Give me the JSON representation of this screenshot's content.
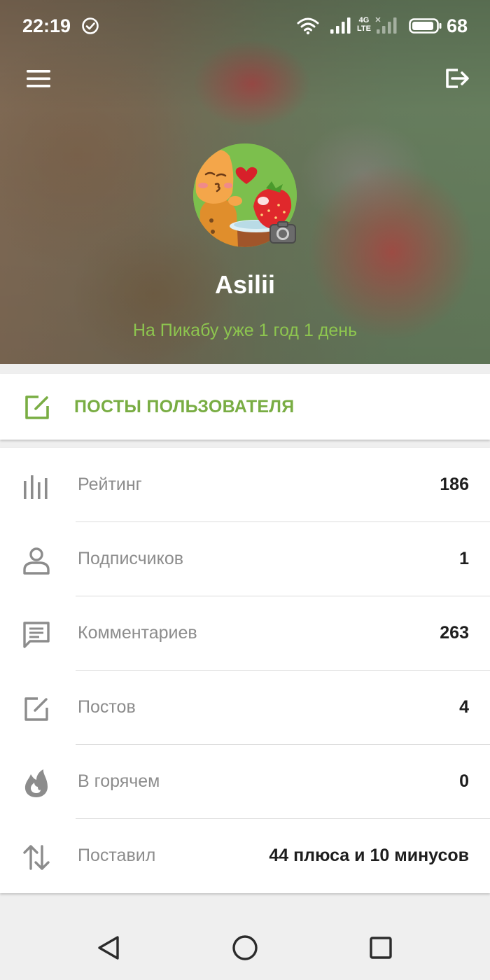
{
  "status_bar": {
    "time": "22:19",
    "network_label_top": "4G",
    "network_label_bottom": "LTE",
    "battery_level": "68"
  },
  "header": {
    "username": "Asilii",
    "member_since": "На Пикабу уже 1 год 1 день"
  },
  "posts_button": {
    "label": "ПОСТЫ ПОЛЬЗОВАТЕЛЯ"
  },
  "stats": [
    {
      "icon": "bar-chart-icon",
      "label": "Рейтинг",
      "value": "186"
    },
    {
      "icon": "person-icon",
      "label": "Подписчиков",
      "value": "1"
    },
    {
      "icon": "comment-icon",
      "label": "Комментариев",
      "value": "263"
    },
    {
      "icon": "edit-icon",
      "label": "Постов",
      "value": "4"
    },
    {
      "icon": "flame-icon",
      "label": "В горячем",
      "value": "0"
    },
    {
      "icon": "sort-arrows-icon",
      "label": "Поставил",
      "value": "44 плюса и 10 минусов"
    }
  ],
  "colors": {
    "accent_green": "#79ad43",
    "member_since_green": "#8dc54f",
    "label_gray": "#8c8c8c",
    "value_dark": "#1e1e1e"
  }
}
